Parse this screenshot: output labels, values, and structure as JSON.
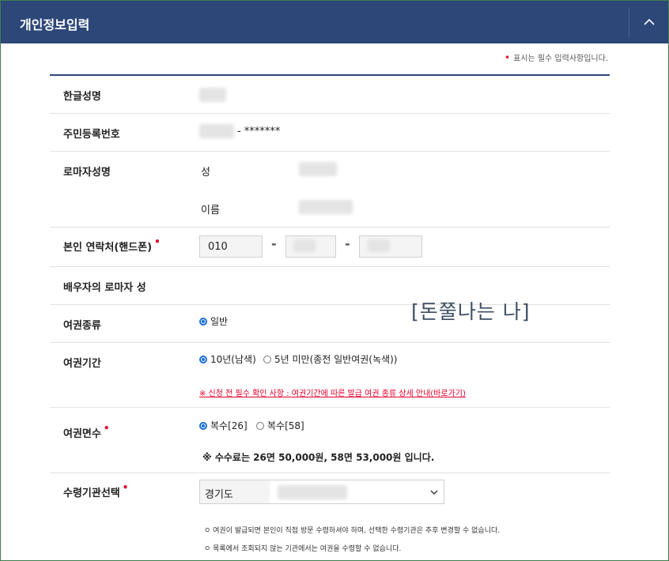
{
  "header": {
    "title": "개인정보입력",
    "toggle_icon": "chevron-up-icon"
  },
  "required_note": {
    "mark": "•",
    "text": "표시는 필수 입력사항입니다."
  },
  "rows": {
    "korean_name": {
      "label": "한글성명"
    },
    "resident_number": {
      "label": "주민등록번호",
      "masked_suffix": "- *******"
    },
    "roman_name": {
      "label": "로마자성명",
      "surname_label": "성",
      "given_label": "이름"
    },
    "phone": {
      "label": "본인 연락처(핸드폰)",
      "prefix": "010",
      "sep1": "-",
      "sep2": "-"
    },
    "spouse_roman": {
      "label": "배우자의 로마자 성"
    },
    "passport_type": {
      "label": "여권종류",
      "options": [
        {
          "label": "일반",
          "selected": true
        }
      ]
    },
    "passport_period": {
      "label": "여권기간",
      "options": [
        {
          "label": "10년(남색)",
          "selected": true
        },
        {
          "label": "5년 미만(종전 일반여권(녹색))",
          "selected": false
        }
      ],
      "warning": "※ 신청 전 필수 확인 사항 : 여권기간에 따른 발급 여권 종류 상세 안내(바로가기)"
    },
    "passport_pages": {
      "label": "여권면수",
      "options": [
        {
          "label": "복수[26]",
          "selected": true
        },
        {
          "label": "복수[58]",
          "selected": false
        }
      ],
      "fee_note": "※ 수수료는 26면 50,000원, 58면 53,000원 입니다."
    },
    "pickup_agency": {
      "label": "수령기관선택",
      "region": "경기도",
      "notes": [
        "ㅇ 여권이 발급되면 본인이 직접 방문 수령하셔야 하며, 선택한 수령기관은 추후 변경할 수 없습니다.",
        "ㅇ 목록에서 조회되지 않는 기관에서는 여권을 수령할 수 없습니다."
      ]
    }
  },
  "watermark": "[돈쭐나는 나]",
  "colors": {
    "header_bg": "#2c4778",
    "required": "#e4002b",
    "radio": "#1b6fd6"
  }
}
